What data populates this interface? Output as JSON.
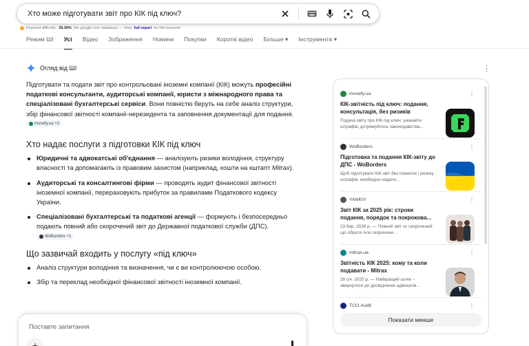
{
  "search": {
    "query": "Хто може підготувати звіт про КІК під ключ?"
  },
  "keyword_difficulty": {
    "label": "Keyword difficulty:",
    "value": "39.30%",
    "source": "(for google.com database) — View",
    "link": "full report",
    "suffix": "for this keyword"
  },
  "tabs": [
    {
      "label": "Режим ШІ"
    },
    {
      "label": "Усі"
    },
    {
      "label": "Відео"
    },
    {
      "label": "Зображення"
    },
    {
      "label": "Новини"
    },
    {
      "label": "Покупки"
    },
    {
      "label": "Короткі відео"
    },
    {
      "label": "Більше ▾"
    },
    {
      "label": "Інструменти ▾"
    }
  ],
  "ai_overview": {
    "title": "Огляд від ШІ",
    "intro_1": "Підготувати та подати звіт про контрольовані іноземні компанії (КІК) можуть ",
    "intro_bold": "професійні податкові консультанти, аудиторські компанії, юристи з міжнародного права та спеціалізовані бухгалтерські сервіси",
    "intro_2": ". Вони повністю беруть на себе аналіз структури, збір фінансової звітності компанії-нерезидента та заповнення документації для подання.",
    "intro_chip": "monefy.ua +2",
    "section1_title": "Хто надає послуги з підготовки КІК під ключ",
    "services": [
      {
        "bold": "Юридичні та адвокатські об'єднання",
        "text": " — аналізують ризики володіння, структуру власності та допомагають із правовим захистом (наприклад, кошти на кштапт ",
        "italic": "Mitrax",
        "after": ")."
      },
      {
        "bold": "Аудиторські та консалтингові фірми",
        "text": " — проводять аудит фінансової звітності іноземної компанії, перераховують прибуток за правилами Податкового кодексу України.",
        "italic": "",
        "after": ""
      },
      {
        "bold": "Спеціалізовані бухгалтерські та податкові агенції",
        "text": " — формують і безпосередньо подають повний або скорочений звіт до Державної податкової служби (ДПС).",
        "italic": "",
        "after": ""
      }
    ],
    "services_chip": "WoBorders +1",
    "section2_title": "Що зазвичай входить у послугу «під ключ»",
    "includes": [
      "Аналіз структури володіння та визначення, чи є ви контролюючою особою.",
      "Збір та переклад необхідної фінансової звітності іноземної компанії."
    ]
  },
  "ask": {
    "placeholder": "Поставте запитання"
  },
  "sources": {
    "cards": [
      {
        "site": "monefy.ua",
        "title": "КІК-звітність під ключ: подання, консультація, без ризиків",
        "snippet": "Подача звіту про КІК під ключ: уникайте штрафів, дотримуйтесь законодавства...",
        "favicon_color": "#1b8a3a"
      },
      {
        "site": "WoBorders",
        "title": "Підготовка та подання КІК-звіту до ДПС - WoBorders",
        "snippet": "Щоб підготувати КІК-звіт без помилок і ризику штрафів, необхідно надати...",
        "favicon_color": "#333333"
      },
      {
        "site": "YANKIV",
        "title": "Звіт КІК за 2025 рік: строки подання, порядок та покрокова...",
        "snippet": "23 бер. 2026 р. — Повний звіт vs скорочений: що обрати Але скорочени...",
        "favicon_color": "#555555"
      },
      {
        "site": "mitrax.ua",
        "title": "Звітність КІК 2025: кому та коли подавати - Mitrax",
        "snippet": "28 січ. 2025 р. — Найкращий шлях – звернутися до досвідчених адвокатів...",
        "favicon_color": "#0b8a8f"
      },
      {
        "site": "TCO-Audit",
        "title": "",
        "snippet": "",
        "favicon_color": "#1a237e"
      }
    ],
    "show_less": "Показати менше"
  },
  "colors": {
    "accent_blue": "#1a0dab",
    "gemini_blue": "#4285f4",
    "flag_blue": "#0057b7",
    "flag_yellow": "#ffd700"
  }
}
